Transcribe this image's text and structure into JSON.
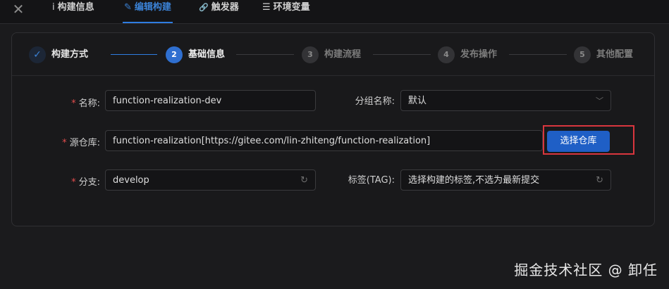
{
  "header": {
    "close_glyph": "✕",
    "tabs": [
      {
        "icon": "i",
        "label": "构建信息",
        "active": false
      },
      {
        "icon": "✎",
        "label": "编辑构建",
        "active": true
      },
      {
        "icon": "🔗",
        "label": "触发器",
        "active": false
      },
      {
        "icon": "☰",
        "label": "环境变量",
        "active": false
      }
    ]
  },
  "steps": [
    {
      "num": "✓",
      "label": "构建方式",
      "state": "done"
    },
    {
      "num": "2",
      "label": "基础信息",
      "state": "current"
    },
    {
      "num": "3",
      "label": "构建流程",
      "state": "wait"
    },
    {
      "num": "4",
      "label": "发布操作",
      "state": "wait"
    },
    {
      "num": "5",
      "label": "其他配置",
      "state": "wait"
    }
  ],
  "form": {
    "required_mark": "*",
    "name_label": "名称:",
    "name_value": "function-realization-dev",
    "group_label": "分组名称:",
    "group_value": "默认",
    "repo_label": "源仓库:",
    "repo_value": "function-realization[https://gitee.com/lin-zhiteng/function-realization]",
    "select_repo_button": "选择仓库",
    "branch_label": "分支:",
    "branch_value": "develop",
    "tag_label": "标签(TAG):",
    "tag_placeholder": "选择构建的标签,不选为最新提交"
  },
  "watermark": "掘金技术社区 @ 卸任",
  "colors": {
    "accent": "#2f7de1",
    "required": "#e34d4d",
    "highlight": "#d9363e"
  }
}
